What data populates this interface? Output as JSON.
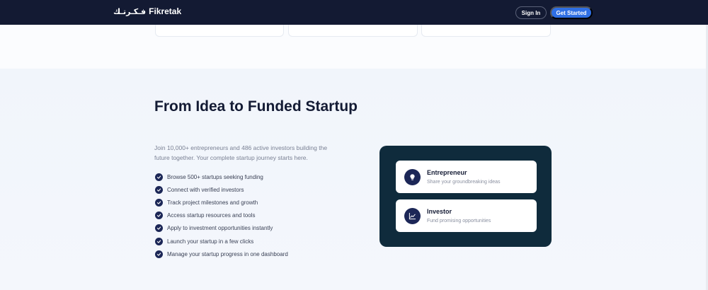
{
  "nav": {
    "logo_arabic": "فـكـرتـك",
    "logo_text": "Fikretak",
    "sign_in": "Sign In",
    "get_started": "Get Started"
  },
  "hero": {
    "headline": "From Idea to Funded Startup",
    "subtext": "Join 10,000+ entrepreneurs and 486 active investors building the future together. Your complete startup journey starts here.",
    "features": [
      "Browse 500+ startups seeking funding",
      "Connect with verified investors",
      "Track project milestones and growth",
      "Access startup resources and tools",
      "Apply to investment opportunities instantly",
      "Launch your startup in a few clicks",
      "Manage your startup progress in one dashboard"
    ]
  },
  "roles": [
    {
      "title": "Entrepreneur",
      "description": "Share your groundbreaking ideas",
      "icon": "lightbulb-icon"
    },
    {
      "title": "Investor",
      "description": "Fund promising opportunities",
      "icon": "chart-icon"
    }
  ],
  "colors": {
    "nav_bg": "#131a33",
    "accent": "#2f6fe4",
    "dark_card": "#0f2b3c",
    "icon_circle": "#1c2757"
  }
}
